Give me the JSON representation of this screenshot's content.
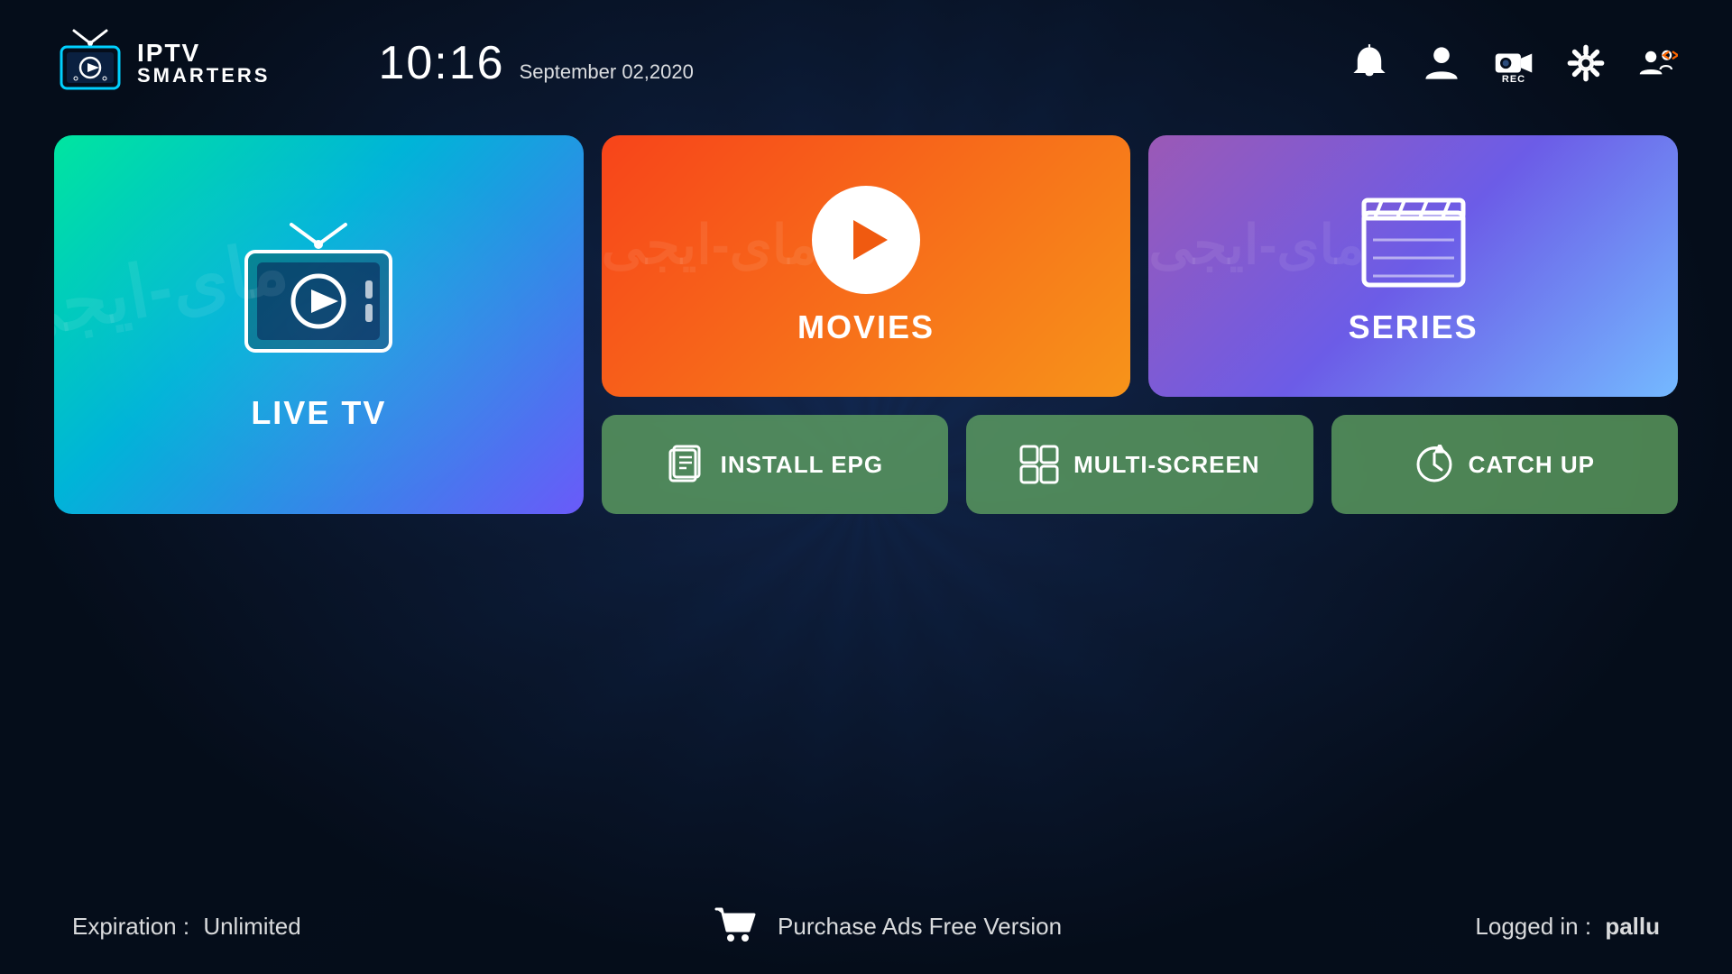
{
  "app": {
    "name": "IPTV SMARTERS",
    "logo_iptv": "IPTV",
    "logo_smarters": "SMARTERS"
  },
  "header": {
    "time": "10:16",
    "date": "September 02,2020",
    "icons": {
      "bell": "bell-icon",
      "user": "user-icon",
      "rec": "rec-icon",
      "settings": "settings-icon",
      "switch_user": "switch-user-icon"
    },
    "rec_label": "REC"
  },
  "cards": {
    "live_tv": {
      "label": "LIVE TV"
    },
    "movies": {
      "label": "MOVIES"
    },
    "series": {
      "label": "SERIES"
    },
    "install_epg": {
      "label": "INSTALL EPG"
    },
    "multi_screen": {
      "label": "MULTI-SCREEN"
    },
    "catch_up": {
      "label": "CATCH UP"
    }
  },
  "footer": {
    "expiry_label": "Expiration :",
    "expiry_value": "Unlimited",
    "purchase_label": "Purchase Ads Free Version",
    "logged_in_label": "Logged in :",
    "logged_in_user": "pallu"
  },
  "colors": {
    "live_tv_gradient_start": "#00e5a0",
    "live_tv_gradient_end": "#6a5af9",
    "movies_gradient_start": "#f7441a",
    "movies_gradient_end": "#f7941a",
    "series_gradient_start": "#9b59b6",
    "series_gradient_end": "#74b9ff",
    "small_card_bg": "rgba(100,170,100,0.75)",
    "bg_dark": "#050d1a"
  }
}
